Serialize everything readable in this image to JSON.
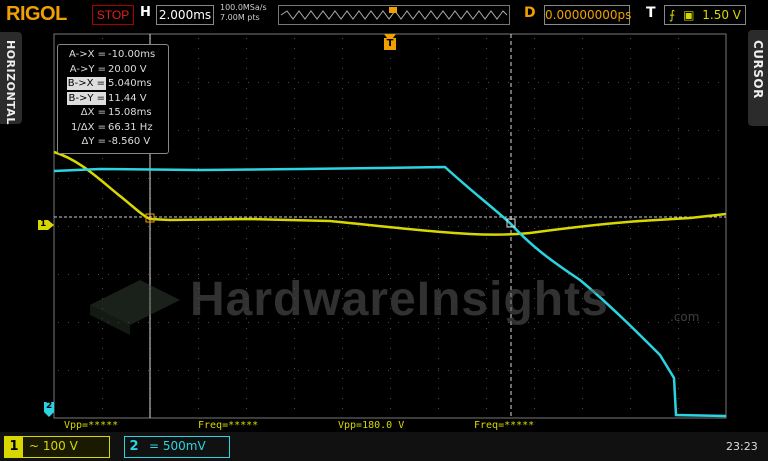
{
  "header": {
    "brand": "RIGOL",
    "run_status": "STOP",
    "horizontal_label": "H",
    "timebase": "2.000ms",
    "sample_rate": "100.0MSa/s",
    "memory_depth": "7.00M pts",
    "delay_label": "D",
    "delay_value": "0.00000000ps",
    "trigger_label": "T",
    "trigger_level": "1.50 V"
  },
  "side_menus": {
    "left": "HORIZONTAL",
    "right": "CURSOR"
  },
  "cursor_readout": [
    {
      "key": "A->X =",
      "value": "-10.00ms",
      "highlight": false
    },
    {
      "key": "A->Y =",
      "value": "20.00 V",
      "highlight": false
    },
    {
      "key": "B->X =",
      "value": "5.040ms",
      "highlight": true
    },
    {
      "key": "B->Y =",
      "value": "11.44 V",
      "highlight": true
    },
    {
      "key": "ΔX =",
      "value": "15.08ms",
      "highlight": false
    },
    {
      "key": "1/ΔX =",
      "value": "66.31 Hz",
      "highlight": false
    },
    {
      "key": "ΔY =",
      "value": "-8.560 V",
      "highlight": false
    }
  ],
  "markers": {
    "trigger_top": "T",
    "ch1_ref": "1",
    "ch2_ref": "2"
  },
  "watermark": {
    "text": "HardwareInsights",
    "suffix": ".com"
  },
  "measurements": [
    {
      "label": "Vpp=*****"
    },
    {
      "label": "Freq=*****"
    },
    {
      "label": "Vpp=180.0 V"
    },
    {
      "label": "Freq=*****"
    }
  ],
  "channels": [
    {
      "number": "1",
      "setting": "~ 100 V",
      "color": "#d8d800"
    },
    {
      "number": "2",
      "setting": "= 500mV",
      "color": "#2ad4e0"
    }
  ],
  "clock": "23:23",
  "colors": {
    "ch1": "#d8d800",
    "ch2": "#2ad4e0",
    "accent": "#f0a000",
    "stop": "#e02020"
  }
}
